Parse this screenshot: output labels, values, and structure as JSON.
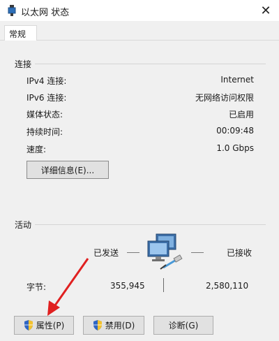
{
  "window": {
    "title": "以太网 状态",
    "close_glyph": "✕"
  },
  "tab": {
    "label": "常规"
  },
  "connection": {
    "heading": "连接",
    "rows": [
      {
        "label": "IPv4 连接:",
        "value": "Internet"
      },
      {
        "label": "IPv6 连接:",
        "value": "无网络访问权限"
      },
      {
        "label": "媒体状态:",
        "value": "已启用"
      },
      {
        "label": "持续时间:",
        "value": "00:09:48"
      },
      {
        "label": "速度:",
        "value": "1.0 Gbps"
      }
    ],
    "details_button": "详细信息(E)..."
  },
  "activity": {
    "heading": "活动",
    "sent_label": "已发送",
    "received_label": "已接收",
    "bytes_label": "字节:",
    "bytes_sent": "355,945",
    "bytes_received": "2,580,110"
  },
  "buttons": {
    "properties": "属性(P)",
    "disable": "禁用(D)",
    "diagnose": "诊断(G)"
  },
  "colors": {
    "annotation_arrow": "#e02020",
    "panel_bg": "#f0f0f0",
    "button_bg": "#e1e1e1"
  },
  "icons": [
    "network-adapter-icon",
    "close-icon",
    "network-computers-icon",
    "uac-shield-icon"
  ]
}
